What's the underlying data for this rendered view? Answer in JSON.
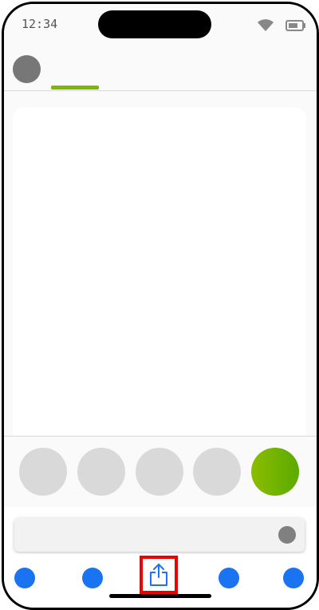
{
  "status_bar": {
    "time": "12:34",
    "wifi_icon": "wifi-icon",
    "battery_icon": "battery-icon"
  },
  "top_bar": {
    "avatar_icon": "avatar",
    "active_tab_indicator_color": "#7fb800"
  },
  "filters": {
    "count": 5,
    "selected_index": 4,
    "inactive_color": "#d9d9d9",
    "selected_gradient": [
      "#8cbc00",
      "#5aab00"
    ]
  },
  "input": {
    "value": "",
    "placeholder": ""
  },
  "bottom_nav": {
    "items": [
      "nav-dot",
      "nav-dot",
      "share-icon",
      "nav-dot",
      "nav-dot"
    ],
    "dot_color": "#1a73f0",
    "highlight_color": "#ee0000",
    "share_icon_color": "#1a73f0"
  }
}
